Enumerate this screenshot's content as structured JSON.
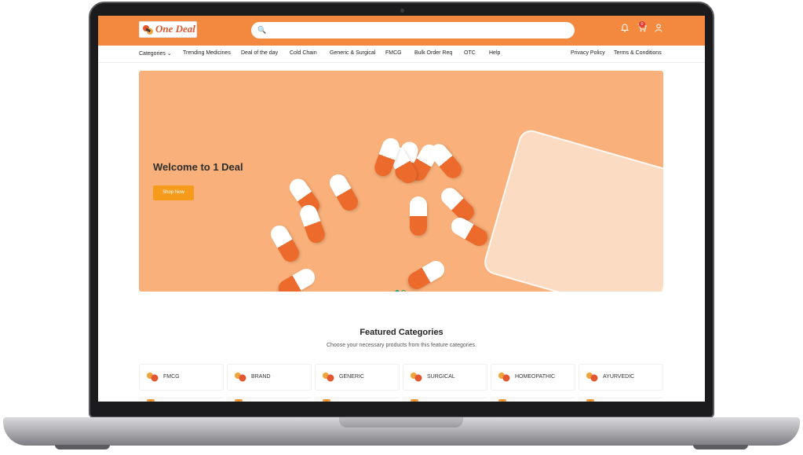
{
  "header": {
    "logo_text": "One Deal",
    "logo_tagline": "",
    "search_placeholder": "",
    "cart_count": "0"
  },
  "nav": {
    "items": [
      "Categories ⌄",
      "Trending Medicines",
      "Deal of the day",
      "Cold Chain",
      "Generic & Surgical",
      "FMCG",
      "Bulk Order Req",
      "OTC",
      "Help"
    ],
    "right_items": [
      "Privacy Policy",
      "Terms & Conditions"
    ]
  },
  "banner": {
    "title": "Welcome to 1 Deal",
    "button": "Shop Now",
    "slides": 2,
    "active_slide": 1
  },
  "featured": {
    "title": "Featured Categories",
    "subtitle": "Choose your necessary products from this feature categories.",
    "categories": [
      "FMCG",
      "BRAND",
      "GENERIC",
      "SURGICAL",
      "HOMEOPATHIC",
      "AYURVEDIC"
    ]
  },
  "colors": {
    "header": "#f2893f",
    "banner": "#f9b07a",
    "button": "#f59a1b",
    "dot": "#21a37a"
  }
}
